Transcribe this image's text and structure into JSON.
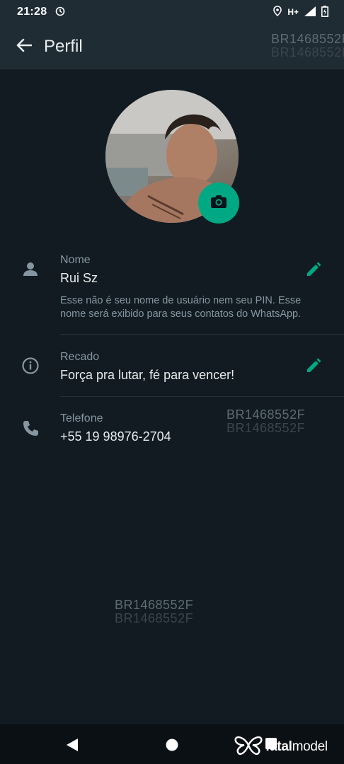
{
  "status_bar": {
    "time": "21:28",
    "network": "H+"
  },
  "app_bar": {
    "title": "Perfil"
  },
  "watermark": "BR1468552F",
  "profile": {
    "name_label": "Nome",
    "name_value": "Rui Sz",
    "name_hint": "Esse não é seu nome de usuário nem seu PIN. Esse nome será exibido para seus contatos do WhatsApp.",
    "about_label": "Recado",
    "about_value": "Força pra lutar, fé para vencer!",
    "phone_label": "Telefone",
    "phone_value": "+55 19 98976-2704"
  },
  "brand": {
    "part1": "f",
    "part2": "atal",
    "part3": "model"
  },
  "colors": {
    "accent": "#00a884",
    "background": "#121b22",
    "appbar": "#1f2c34"
  }
}
